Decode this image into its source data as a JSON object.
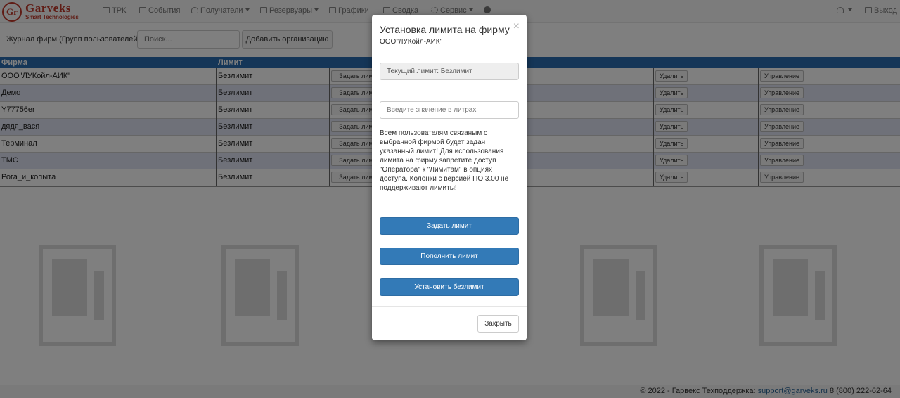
{
  "brand": {
    "logo_mark": "Gr",
    "name": "Garveks",
    "tagline": "Smart Technologies"
  },
  "nav": {
    "items": [
      {
        "label": "ТРК",
        "icon": "fuel-icon",
        "dropdown": false
      },
      {
        "label": "События",
        "icon": "events-icon",
        "dropdown": false
      },
      {
        "label": "Получатели",
        "icon": "user-icon",
        "dropdown": true
      },
      {
        "label": "Резервуары",
        "icon": "tank-icon",
        "dropdown": true
      },
      {
        "label": "Графики",
        "icon": "chart-icon",
        "dropdown": false
      },
      {
        "label": "Сводка",
        "icon": "summary-icon",
        "dropdown": false
      },
      {
        "label": "Сервис",
        "icon": "gear-icon",
        "dropdown": true
      }
    ],
    "help_icon": "question-icon",
    "user_icon": "user-icon",
    "logout_label": "Выход"
  },
  "toolbar": {
    "label": "Журнал фирм (Групп пользователей):",
    "search_placeholder": "Поиск...",
    "add_button": "Добавить организацию"
  },
  "table": {
    "columns": [
      "Фирма",
      "Лимит"
    ],
    "rows": [
      {
        "firm": "ООО\"ЛУКойл-АИК\"",
        "limit": "Безлимит"
      },
      {
        "firm": "Демо",
        "limit": "Безлимит"
      },
      {
        "firm": "Y77756er",
        "limit": "Безлимит"
      },
      {
        "firm": "дядя_вася",
        "limit": "Безлимит"
      },
      {
        "firm": "Терминал",
        "limit": "Безлимит"
      },
      {
        "firm": "ТМС",
        "limit": "Безлимит"
      },
      {
        "firm": "Рога_и_копыта",
        "limit": "Безлимит"
      }
    ],
    "row_buttons": {
      "set_limit": "Задать лимит",
      "delete": "Удалить",
      "manage": "Управление"
    }
  },
  "footer": {
    "text": "© 2022 - Гарвекс Техподдержка:",
    "email": "support@garveks.ru",
    "phone": "8 (800) 222-62-64"
  },
  "modal": {
    "title": "Установка лимита на фирму",
    "subtitle": "ООО\"ЛУКойл-АИК\"",
    "close_symbol": "×",
    "current_limit": "Текущий лимит: Безлимит",
    "input_placeholder": "Введите значение в литрах",
    "note": "Всем пользователям связаным с выбранной фирмой будет задан указанный лимит! Для использования лимита на фирму запретите доступ \"Оператора\" к \"Лимитам\" в опциях доступа. Колонки с версией ПО 3.00 не поддерживают лимиты!",
    "set_limit_button": "Задать лимит",
    "top_up_button": "Пополнить лимит",
    "unlimited_button": "Установить безлимит",
    "close_button": "Закрыть"
  },
  "colors": {
    "brand_red": "#c0392b",
    "header_blue": "#2b6cb0",
    "primary_blue": "#337ab7",
    "row_alt": "#dfe3f2"
  }
}
